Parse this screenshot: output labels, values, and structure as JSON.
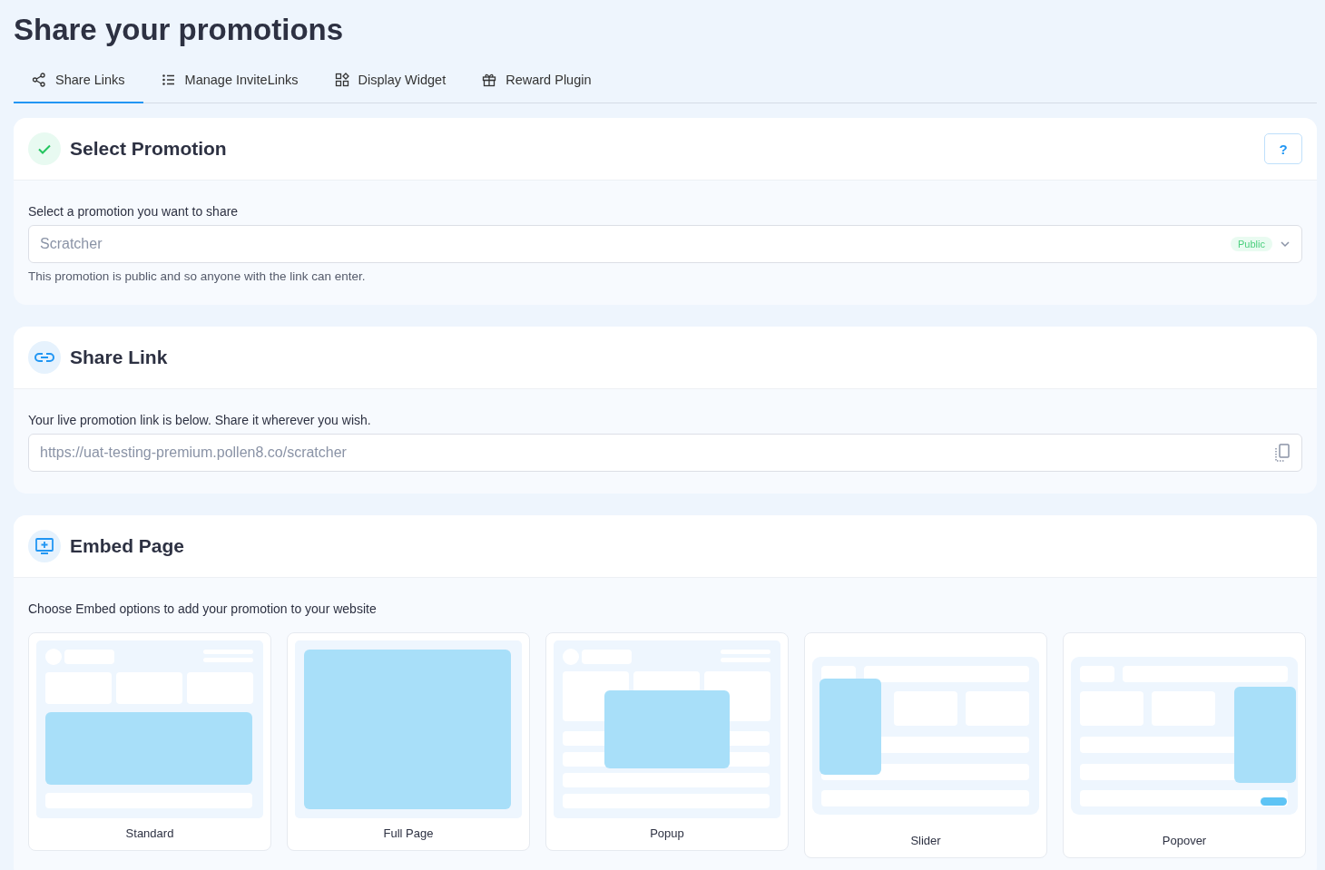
{
  "page": {
    "title": "Share your promotions"
  },
  "tabs": [
    {
      "label": "Share Links",
      "selected": true
    },
    {
      "label": "Manage InviteLinks",
      "selected": false
    },
    {
      "label": "Display Widget",
      "selected": false
    },
    {
      "label": "Reward Plugin",
      "selected": false
    }
  ],
  "select_promotion": {
    "title": "Select Promotion",
    "help_button": "?",
    "field_label": "Select a promotion you want to share",
    "select": {
      "value": "Scratcher",
      "badge": "Public"
    },
    "hint": "This promotion is public and so anyone with the link can enter."
  },
  "share_link": {
    "title": "Share Link",
    "field_label": "Your live promotion link is below. Share it wherever you wish.",
    "link_field": {
      "value": "https://uat-testing-premium.pollen8.co/scratcher"
    }
  },
  "embed_page": {
    "title": "Embed Page",
    "description": "Choose Embed options to add your promotion to your website",
    "options": [
      {
        "label": "Standard",
        "kind": "standard"
      },
      {
        "label": "Full Page",
        "kind": "fullpage"
      },
      {
        "label": "Popup",
        "kind": "popup"
      },
      {
        "label": "Slider",
        "kind": "slider"
      },
      {
        "label": "Popover",
        "kind": "popover"
      }
    ]
  }
}
